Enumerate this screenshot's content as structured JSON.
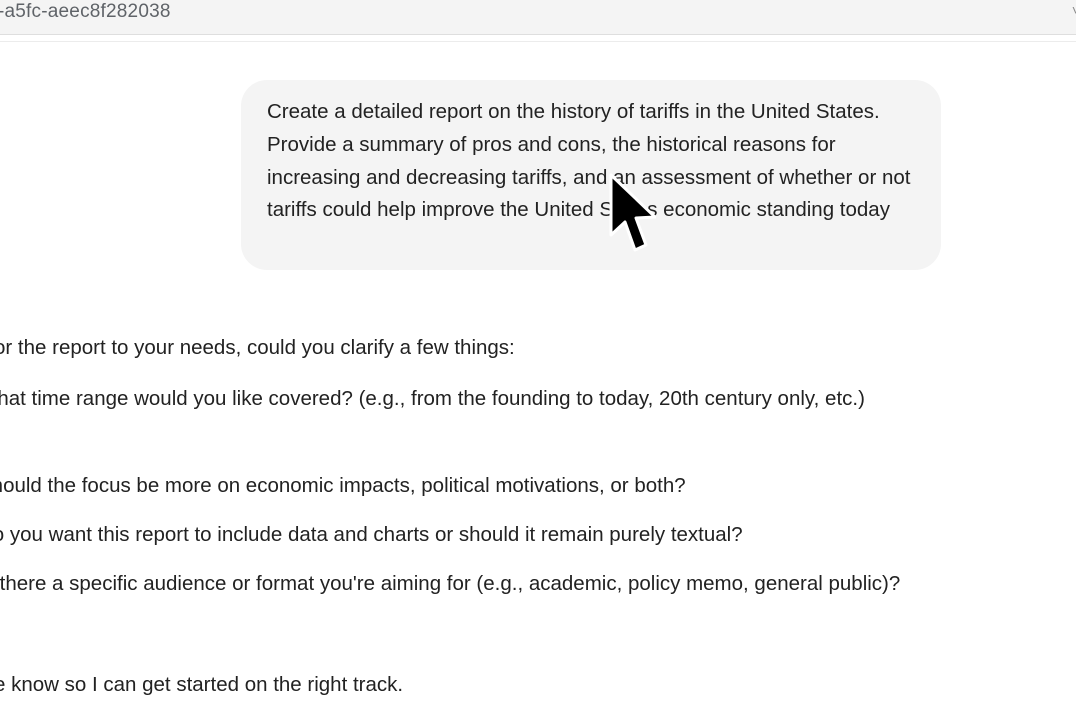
{
  "browser": {
    "url_fragment": "-a5fc-aeec8f282038",
    "menu_chevron": "˅"
  },
  "chat": {
    "user_message": "Create a detailed report on the history of tariffs in the United States. Provide a summary of pros and cons, the historical reasons for increasing and decreasing tariffs, and an assessment of whether or not tariffs could help improve the United States economic standing today",
    "assistant": {
      "intro": "or the report to your needs, could you clarify a few things:",
      "questions": [
        "What time range would you like covered? (e.g., from the founding to today, 20th century only, etc.)",
        "Should the focus be more on economic impacts, political motivations, or both?",
        "Do you want this report to include data and charts or should it remain purely textual?",
        "Is there a specific audience or format you're aiming for (e.g., academic, policy memo, general public)?"
      ],
      "outro": "e know so I can get started on the right track."
    }
  },
  "cursor": {
    "icon": "arrow-cursor-icon"
  }
}
